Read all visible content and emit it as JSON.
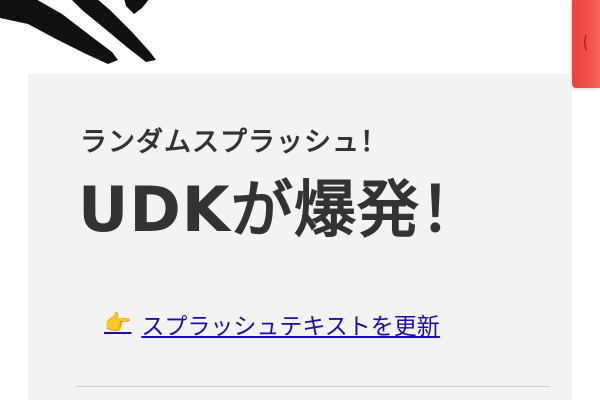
{
  "splash": {
    "subtitle": "ランダムスプラッシュ！",
    "title": "UDKが爆発！",
    "refresh_link": {
      "icon": "👉",
      "icon_name": "pointing-hand-icon",
      "label": "スプラッシュテキストを更新"
    }
  },
  "decorations": {
    "brush_color": "#111111",
    "edge_tab_color": "#ef4a44",
    "edge_tab_glyph": "("
  },
  "colors": {
    "card_background": "#f3f3f3",
    "text": "#333333",
    "link": "#1a0dab",
    "divider": "#cfcfcf"
  }
}
